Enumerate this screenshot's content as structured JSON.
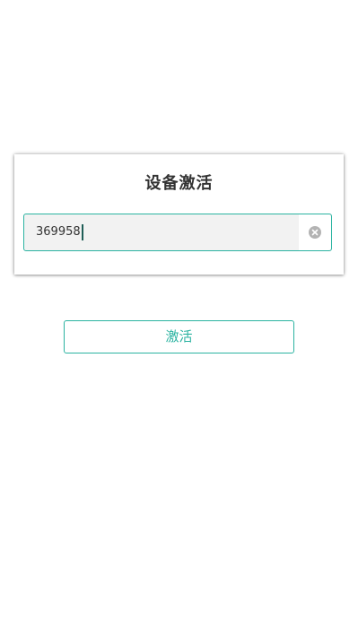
{
  "dialog": {
    "title": "设备激活",
    "input": {
      "value": "369958",
      "clear_icon": "clear-circle-icon"
    }
  },
  "actions": {
    "activate_label": "激活"
  },
  "colors": {
    "accent": "#2bb3a1",
    "title_text": "#333333",
    "input_bg": "#f2f2f2",
    "clear_icon": "#b3b3b3"
  }
}
